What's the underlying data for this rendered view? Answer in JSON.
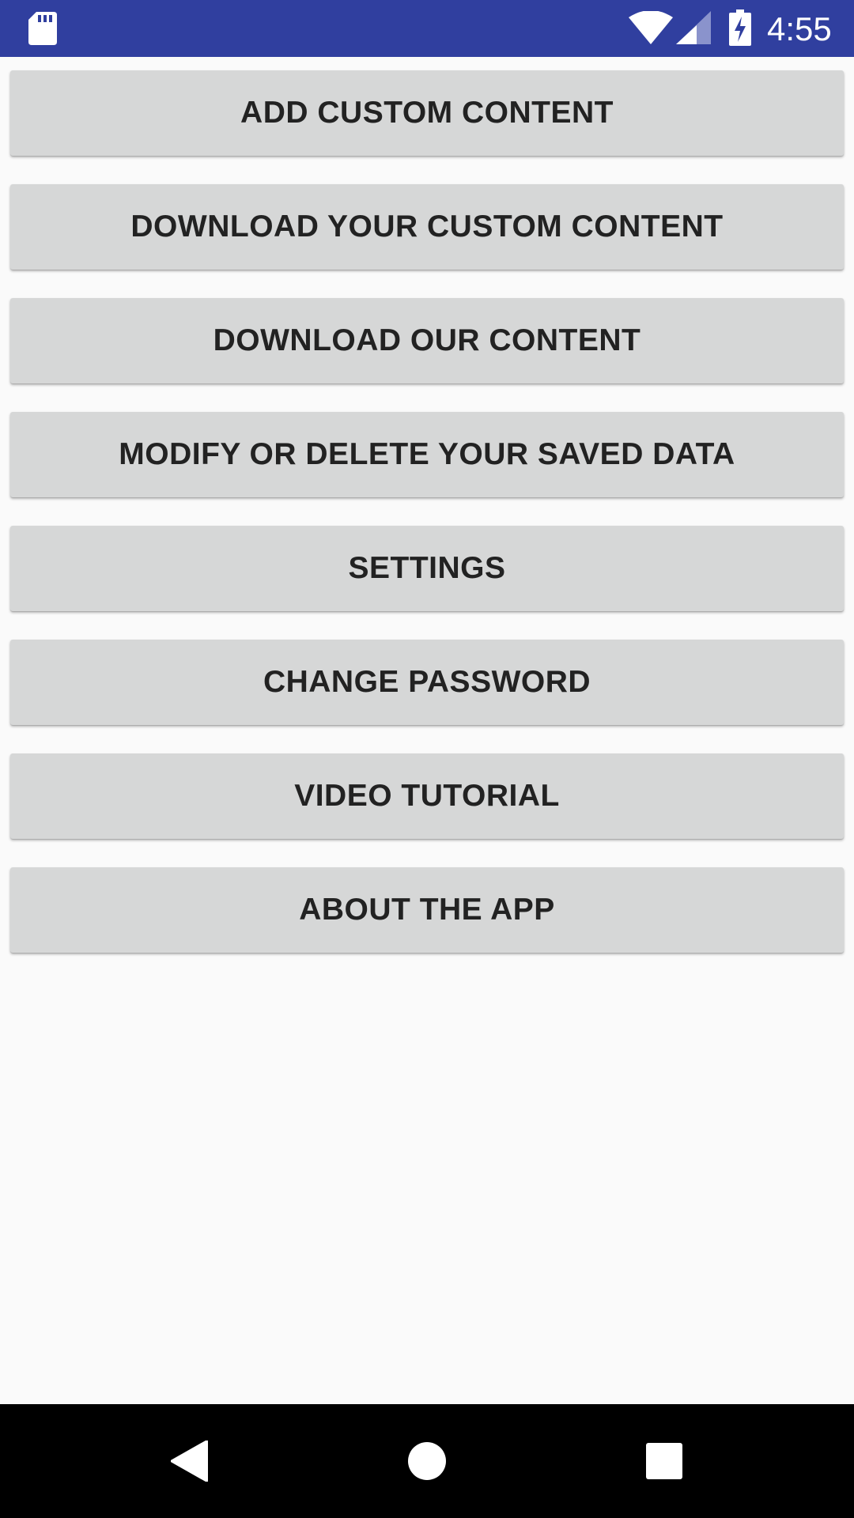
{
  "status_bar": {
    "time": "4:55",
    "background": "#303f9f",
    "icons": [
      "sd-card-icon",
      "wifi-icon",
      "cell-signal-icon",
      "battery-charging-icon"
    ]
  },
  "menu": {
    "buttons": [
      {
        "label": "ADD CUSTOM CONTENT"
      },
      {
        "label": "DOWNLOAD YOUR CUSTOM CONTENT"
      },
      {
        "label": "DOWNLOAD OUR CONTENT"
      },
      {
        "label": "MODIFY OR DELETE YOUR SAVED DATA"
      },
      {
        "label": "SETTINGS"
      },
      {
        "label": "CHANGE PASSWORD"
      },
      {
        "label": "VIDEO TUTORIAL"
      },
      {
        "label": "ABOUT THE APP"
      }
    ],
    "button_color": "#d6d7d7",
    "text_color": "#222222"
  },
  "nav_bar": {
    "icons": [
      "back-icon",
      "home-icon",
      "recents-icon"
    ]
  }
}
